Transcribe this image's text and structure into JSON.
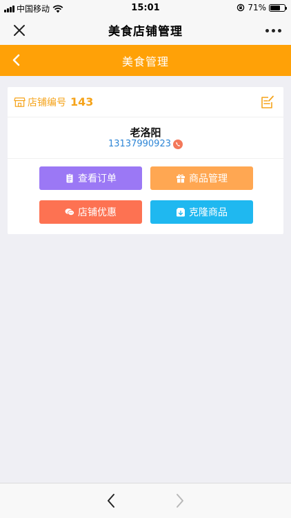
{
  "status_bar": {
    "carrier": "中国移动",
    "time": "15:01",
    "battery": "71%",
    "battery_level": 0.71
  },
  "nav": {
    "title": "美食店铺管理"
  },
  "header": {
    "title": "美食管理"
  },
  "store": {
    "label": "店铺编号",
    "number": "143",
    "owner": "老洛阳",
    "phone": "13137990923"
  },
  "actions": {
    "view_orders": "查看订单",
    "product_mgmt": "商品管理",
    "store_discount": "店铺优惠",
    "clone_products": "克隆商品"
  },
  "colors": {
    "header": "#ffa107",
    "accent": "#f5a31a",
    "orders_btn": "#9b78f5",
    "products_btn": "#ffa752",
    "discount_btn": "#fd7252",
    "clone_btn": "#1fb8f0",
    "phone_link": "#2e86d6"
  },
  "icons": [
    "signal-icon",
    "wifi-icon",
    "rotation-lock-icon",
    "battery-icon",
    "close-icon",
    "more-icon",
    "back-icon",
    "store-icon",
    "edit-icon",
    "phone-icon",
    "clipboard-icon",
    "gift-icon",
    "chat-icon",
    "clone-icon",
    "chevron-left-icon",
    "chevron-right-icon"
  ]
}
